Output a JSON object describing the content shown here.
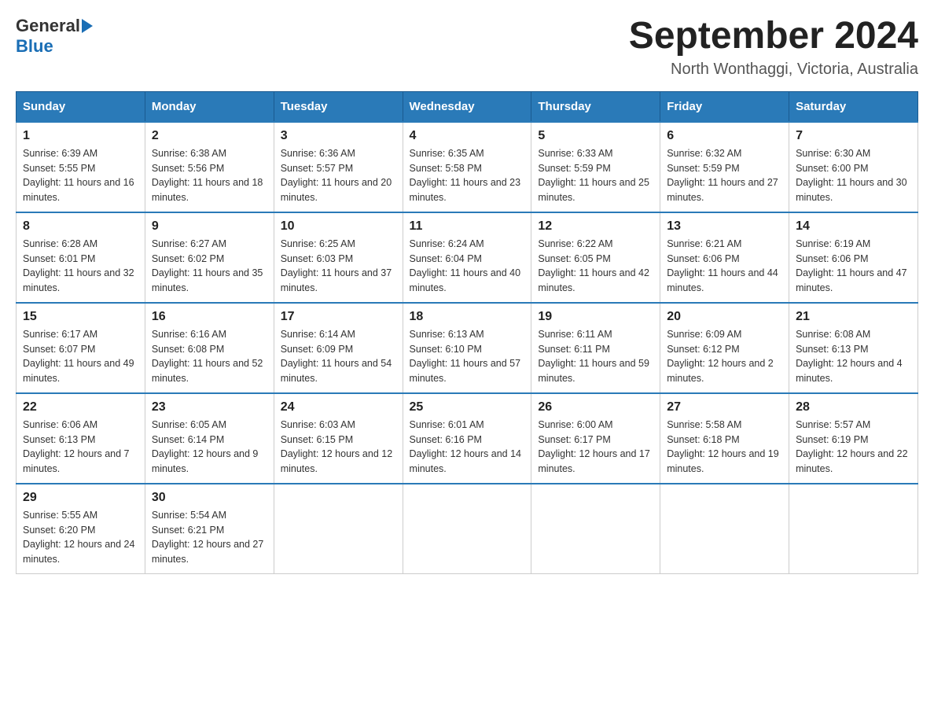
{
  "header": {
    "logo_general": "General",
    "logo_blue": "Blue",
    "title": "September 2024",
    "location": "North Wonthaggi, Victoria, Australia"
  },
  "weekdays": [
    "Sunday",
    "Monday",
    "Tuesday",
    "Wednesday",
    "Thursday",
    "Friday",
    "Saturday"
  ],
  "weeks": [
    [
      {
        "day": "1",
        "sunrise": "Sunrise: 6:39 AM",
        "sunset": "Sunset: 5:55 PM",
        "daylight": "Daylight: 11 hours and 16 minutes."
      },
      {
        "day": "2",
        "sunrise": "Sunrise: 6:38 AM",
        "sunset": "Sunset: 5:56 PM",
        "daylight": "Daylight: 11 hours and 18 minutes."
      },
      {
        "day": "3",
        "sunrise": "Sunrise: 6:36 AM",
        "sunset": "Sunset: 5:57 PM",
        "daylight": "Daylight: 11 hours and 20 minutes."
      },
      {
        "day": "4",
        "sunrise": "Sunrise: 6:35 AM",
        "sunset": "Sunset: 5:58 PM",
        "daylight": "Daylight: 11 hours and 23 minutes."
      },
      {
        "day": "5",
        "sunrise": "Sunrise: 6:33 AM",
        "sunset": "Sunset: 5:59 PM",
        "daylight": "Daylight: 11 hours and 25 minutes."
      },
      {
        "day": "6",
        "sunrise": "Sunrise: 6:32 AM",
        "sunset": "Sunset: 5:59 PM",
        "daylight": "Daylight: 11 hours and 27 minutes."
      },
      {
        "day": "7",
        "sunrise": "Sunrise: 6:30 AM",
        "sunset": "Sunset: 6:00 PM",
        "daylight": "Daylight: 11 hours and 30 minutes."
      }
    ],
    [
      {
        "day": "8",
        "sunrise": "Sunrise: 6:28 AM",
        "sunset": "Sunset: 6:01 PM",
        "daylight": "Daylight: 11 hours and 32 minutes."
      },
      {
        "day": "9",
        "sunrise": "Sunrise: 6:27 AM",
        "sunset": "Sunset: 6:02 PM",
        "daylight": "Daylight: 11 hours and 35 minutes."
      },
      {
        "day": "10",
        "sunrise": "Sunrise: 6:25 AM",
        "sunset": "Sunset: 6:03 PM",
        "daylight": "Daylight: 11 hours and 37 minutes."
      },
      {
        "day": "11",
        "sunrise": "Sunrise: 6:24 AM",
        "sunset": "Sunset: 6:04 PM",
        "daylight": "Daylight: 11 hours and 40 minutes."
      },
      {
        "day": "12",
        "sunrise": "Sunrise: 6:22 AM",
        "sunset": "Sunset: 6:05 PM",
        "daylight": "Daylight: 11 hours and 42 minutes."
      },
      {
        "day": "13",
        "sunrise": "Sunrise: 6:21 AM",
        "sunset": "Sunset: 6:06 PM",
        "daylight": "Daylight: 11 hours and 44 minutes."
      },
      {
        "day": "14",
        "sunrise": "Sunrise: 6:19 AM",
        "sunset": "Sunset: 6:06 PM",
        "daylight": "Daylight: 11 hours and 47 minutes."
      }
    ],
    [
      {
        "day": "15",
        "sunrise": "Sunrise: 6:17 AM",
        "sunset": "Sunset: 6:07 PM",
        "daylight": "Daylight: 11 hours and 49 minutes."
      },
      {
        "day": "16",
        "sunrise": "Sunrise: 6:16 AM",
        "sunset": "Sunset: 6:08 PM",
        "daylight": "Daylight: 11 hours and 52 minutes."
      },
      {
        "day": "17",
        "sunrise": "Sunrise: 6:14 AM",
        "sunset": "Sunset: 6:09 PM",
        "daylight": "Daylight: 11 hours and 54 minutes."
      },
      {
        "day": "18",
        "sunrise": "Sunrise: 6:13 AM",
        "sunset": "Sunset: 6:10 PM",
        "daylight": "Daylight: 11 hours and 57 minutes."
      },
      {
        "day": "19",
        "sunrise": "Sunrise: 6:11 AM",
        "sunset": "Sunset: 6:11 PM",
        "daylight": "Daylight: 11 hours and 59 minutes."
      },
      {
        "day": "20",
        "sunrise": "Sunrise: 6:09 AM",
        "sunset": "Sunset: 6:12 PM",
        "daylight": "Daylight: 12 hours and 2 minutes."
      },
      {
        "day": "21",
        "sunrise": "Sunrise: 6:08 AM",
        "sunset": "Sunset: 6:13 PM",
        "daylight": "Daylight: 12 hours and 4 minutes."
      }
    ],
    [
      {
        "day": "22",
        "sunrise": "Sunrise: 6:06 AM",
        "sunset": "Sunset: 6:13 PM",
        "daylight": "Daylight: 12 hours and 7 minutes."
      },
      {
        "day": "23",
        "sunrise": "Sunrise: 6:05 AM",
        "sunset": "Sunset: 6:14 PM",
        "daylight": "Daylight: 12 hours and 9 minutes."
      },
      {
        "day": "24",
        "sunrise": "Sunrise: 6:03 AM",
        "sunset": "Sunset: 6:15 PM",
        "daylight": "Daylight: 12 hours and 12 minutes."
      },
      {
        "day": "25",
        "sunrise": "Sunrise: 6:01 AM",
        "sunset": "Sunset: 6:16 PM",
        "daylight": "Daylight: 12 hours and 14 minutes."
      },
      {
        "day": "26",
        "sunrise": "Sunrise: 6:00 AM",
        "sunset": "Sunset: 6:17 PM",
        "daylight": "Daylight: 12 hours and 17 minutes."
      },
      {
        "day": "27",
        "sunrise": "Sunrise: 5:58 AM",
        "sunset": "Sunset: 6:18 PM",
        "daylight": "Daylight: 12 hours and 19 minutes."
      },
      {
        "day": "28",
        "sunrise": "Sunrise: 5:57 AM",
        "sunset": "Sunset: 6:19 PM",
        "daylight": "Daylight: 12 hours and 22 minutes."
      }
    ],
    [
      {
        "day": "29",
        "sunrise": "Sunrise: 5:55 AM",
        "sunset": "Sunset: 6:20 PM",
        "daylight": "Daylight: 12 hours and 24 minutes."
      },
      {
        "day": "30",
        "sunrise": "Sunrise: 5:54 AM",
        "sunset": "Sunset: 6:21 PM",
        "daylight": "Daylight: 12 hours and 27 minutes."
      },
      null,
      null,
      null,
      null,
      null
    ]
  ]
}
